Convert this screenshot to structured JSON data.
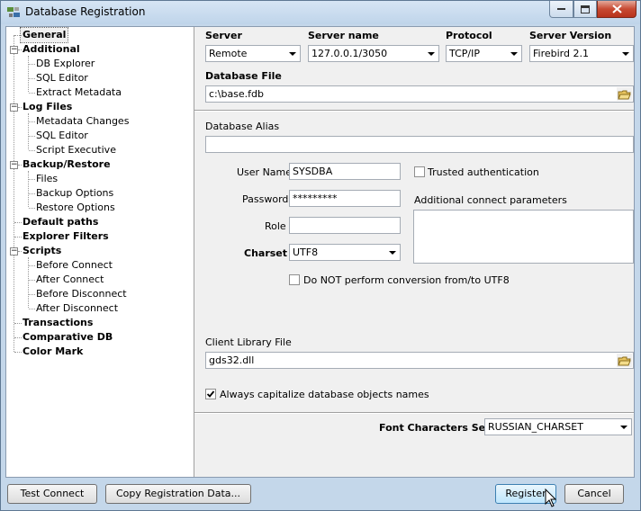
{
  "window": {
    "title": "Database Registration"
  },
  "tree": {
    "items": [
      {
        "label": "General",
        "level": 0,
        "selected": true
      },
      {
        "label": "Additional",
        "level": 0,
        "expander": "minus"
      },
      {
        "label": "DB Explorer",
        "level": 1
      },
      {
        "label": "SQL Editor",
        "level": 1
      },
      {
        "label": "Extract Metadata",
        "level": 1
      },
      {
        "label": "Log Files",
        "level": 0,
        "expander": "minus"
      },
      {
        "label": "Metadata Changes",
        "level": 1
      },
      {
        "label": "SQL Editor",
        "level": 1
      },
      {
        "label": "Script Executive",
        "level": 1
      },
      {
        "label": "Backup/Restore",
        "level": 0,
        "expander": "minus"
      },
      {
        "label": "Files",
        "level": 1
      },
      {
        "label": "Backup Options",
        "level": 1
      },
      {
        "label": "Restore Options",
        "level": 1
      },
      {
        "label": "Default paths",
        "level": 0
      },
      {
        "label": "Explorer Filters",
        "level": 0
      },
      {
        "label": "Scripts",
        "level": 0,
        "expander": "minus"
      },
      {
        "label": "Before Connect",
        "level": 1
      },
      {
        "label": "After Connect",
        "level": 1
      },
      {
        "label": "Before Disconnect",
        "level": 1
      },
      {
        "label": "After Disconnect",
        "level": 1
      },
      {
        "label": "Transactions",
        "level": 0
      },
      {
        "label": "Comparative DB",
        "level": 0
      },
      {
        "label": "Color Mark",
        "level": 0
      }
    ]
  },
  "general": {
    "server_label": "Server",
    "server_value": "Remote",
    "server_name_label": "Server name",
    "server_name_value": "127.0.0.1/3050",
    "protocol_label": "Protocol",
    "protocol_value": "TCP/IP",
    "server_version_label": "Server Version",
    "server_version_value": "Firebird 2.1",
    "database_file_label": "Database File",
    "database_file_value": "c:\\base.fdb",
    "database_alias_label": "Database Alias",
    "database_alias_value": "",
    "user_name_label": "User Name",
    "user_name_value": "SYSDBA",
    "password_label": "Password",
    "password_value": "*********",
    "role_label": "Role",
    "role_value": "",
    "charset_label": "Charset",
    "charset_value": "UTF8",
    "trusted_auth_label": "Trusted authentication",
    "trusted_auth_checked": false,
    "additional_params_label": "Additional connect parameters",
    "no_conversion_label": "Do NOT perform conversion from/to UTF8",
    "no_conversion_checked": false,
    "client_library_label": "Client Library File",
    "client_library_value": "gds32.dll",
    "capitalize_label": "Always capitalize database objects names",
    "capitalize_checked": true,
    "font_charset_label": "Font Characters Set",
    "font_charset_value": "RUSSIAN_CHARSET"
  },
  "buttons": {
    "test_connect": "Test Connect",
    "copy_registration": "Copy Registration Data...",
    "register": "Register",
    "cancel": "Cancel"
  }
}
